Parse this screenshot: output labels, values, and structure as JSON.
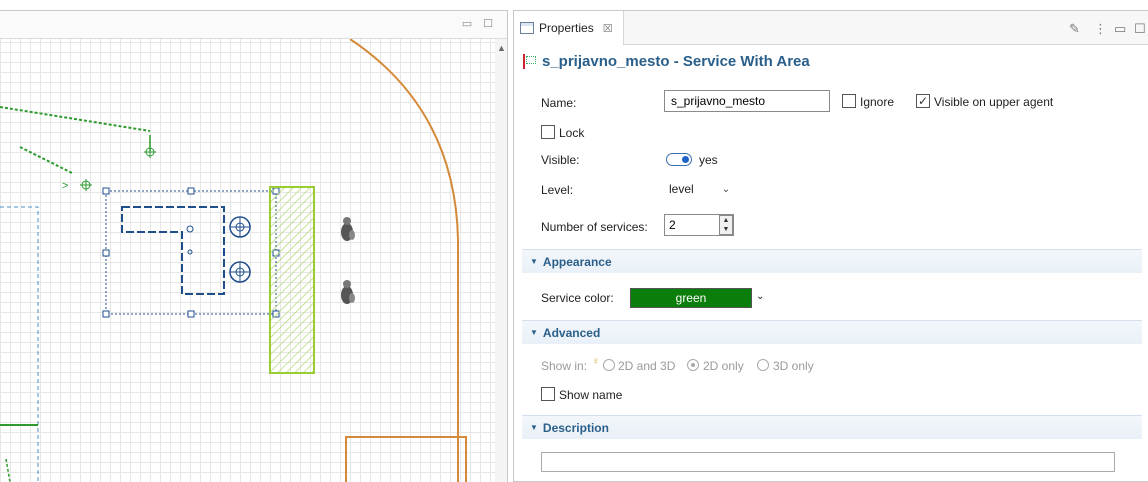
{
  "canvas_pane": {
    "controls": {
      "minimize_icon": "minimize-icon",
      "maximize_icon": "maximize-icon"
    }
  },
  "properties": {
    "tab_label": "Properties",
    "close_glyph": "☒",
    "title": "s_prijavno_mesto - Service With Area",
    "fields": {
      "name_label": "Name:",
      "name_value": "s_prijavno_mesto",
      "ignore_label": "Ignore",
      "visible_upper_label": "Visible on upper agent",
      "lock_label": "Lock",
      "visible_label": "Visible:",
      "visible_value": "yes",
      "level_label": "Level:",
      "level_value": "level",
      "num_services_label": "Number of services:",
      "num_services_value": "2"
    },
    "sections": {
      "appearance": "Appearance",
      "advanced": "Advanced",
      "description": "Description"
    },
    "appearance": {
      "service_color_label": "Service color:",
      "service_color_value": "green",
      "service_color_hex": "#0a7d0a"
    },
    "advanced": {
      "show_in_label": "Show in:",
      "opt_2d3d": "2D and 3D",
      "opt_2d": "2D only",
      "opt_3d": "3D only",
      "show_name_label": "Show name"
    },
    "checks": {
      "ignore": false,
      "visible_upper": true,
      "lock": false,
      "show_name": false
    }
  },
  "colors": {
    "accent": "#2a5f8a",
    "path_green": "#2e9a2e",
    "wall_orange": "#d48a3a",
    "area_green": "#9acd32",
    "selection_blue": "#1f4e8c"
  }
}
